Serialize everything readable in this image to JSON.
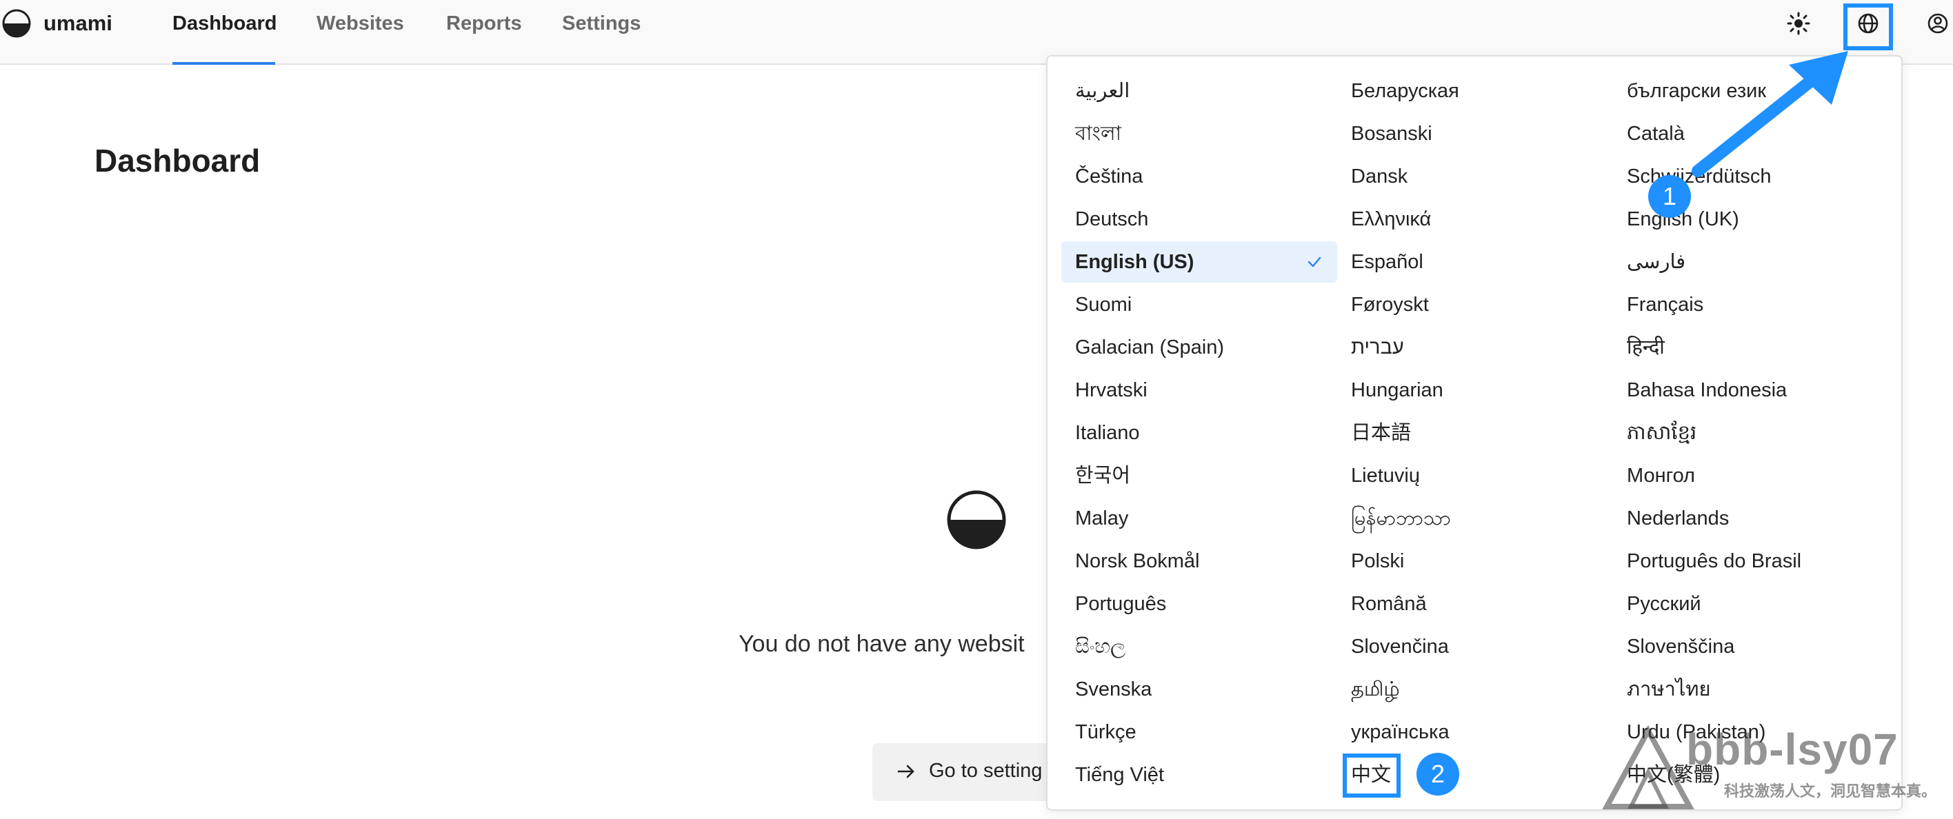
{
  "app": {
    "brand": "umami",
    "nav": [
      {
        "label": "Dashboard",
        "active": true
      },
      {
        "label": "Websites",
        "active": false
      },
      {
        "label": "Reports",
        "active": false
      },
      {
        "label": "Settings",
        "active": false
      }
    ],
    "header_icons": [
      "sun-icon",
      "globe-icon",
      "user-circle-icon"
    ]
  },
  "main": {
    "title": "Dashboard",
    "empty_message": "You do not have any websit",
    "button_label": "Go to setting"
  },
  "language_menu": {
    "selected": "English (US)",
    "columns": [
      [
        "العربية",
        "বাংলা",
        "Čeština",
        "Deutsch",
        "English (US)",
        "Suomi",
        "Galacian (Spain)",
        "Hrvatski",
        "Italiano",
        "한국어",
        "Malay",
        "Norsk Bokmål",
        "Português",
        "සිංහල",
        "Svenska",
        "Türkçe",
        "Tiếng Việt"
      ],
      [
        "Беларуская",
        "Bosanski",
        "Dansk",
        "Ελληνικά",
        "Español",
        "Føroyskt",
        "עברית",
        "Hungarian",
        "日本語",
        "Lietuvių",
        "မြန်မာဘာသာ",
        "Polski",
        "Română",
        "Slovenčina",
        "தமிழ்",
        "українська",
        "中文"
      ],
      [
        "български език",
        "Català",
        "Schwiizerdütsch",
        "English (UK)",
        "فارسی",
        "Français",
        "हिन्दी",
        "Bahasa Indonesia",
        "ភាសាខ្មែរ",
        "Монгол",
        "Nederlands",
        "Português do Brasil",
        "Русский",
        "Slovenščina",
        "ภาษาไทย",
        "Urdu (Pakistan)",
        "中文(繁體)"
      ]
    ]
  },
  "annotations": {
    "step1": "1",
    "step2": "2",
    "accent": "#1e90ff"
  },
  "watermark": {
    "main": "bbb-lsy07",
    "sub": "科技激荡人文，洞见智慧本真。"
  }
}
